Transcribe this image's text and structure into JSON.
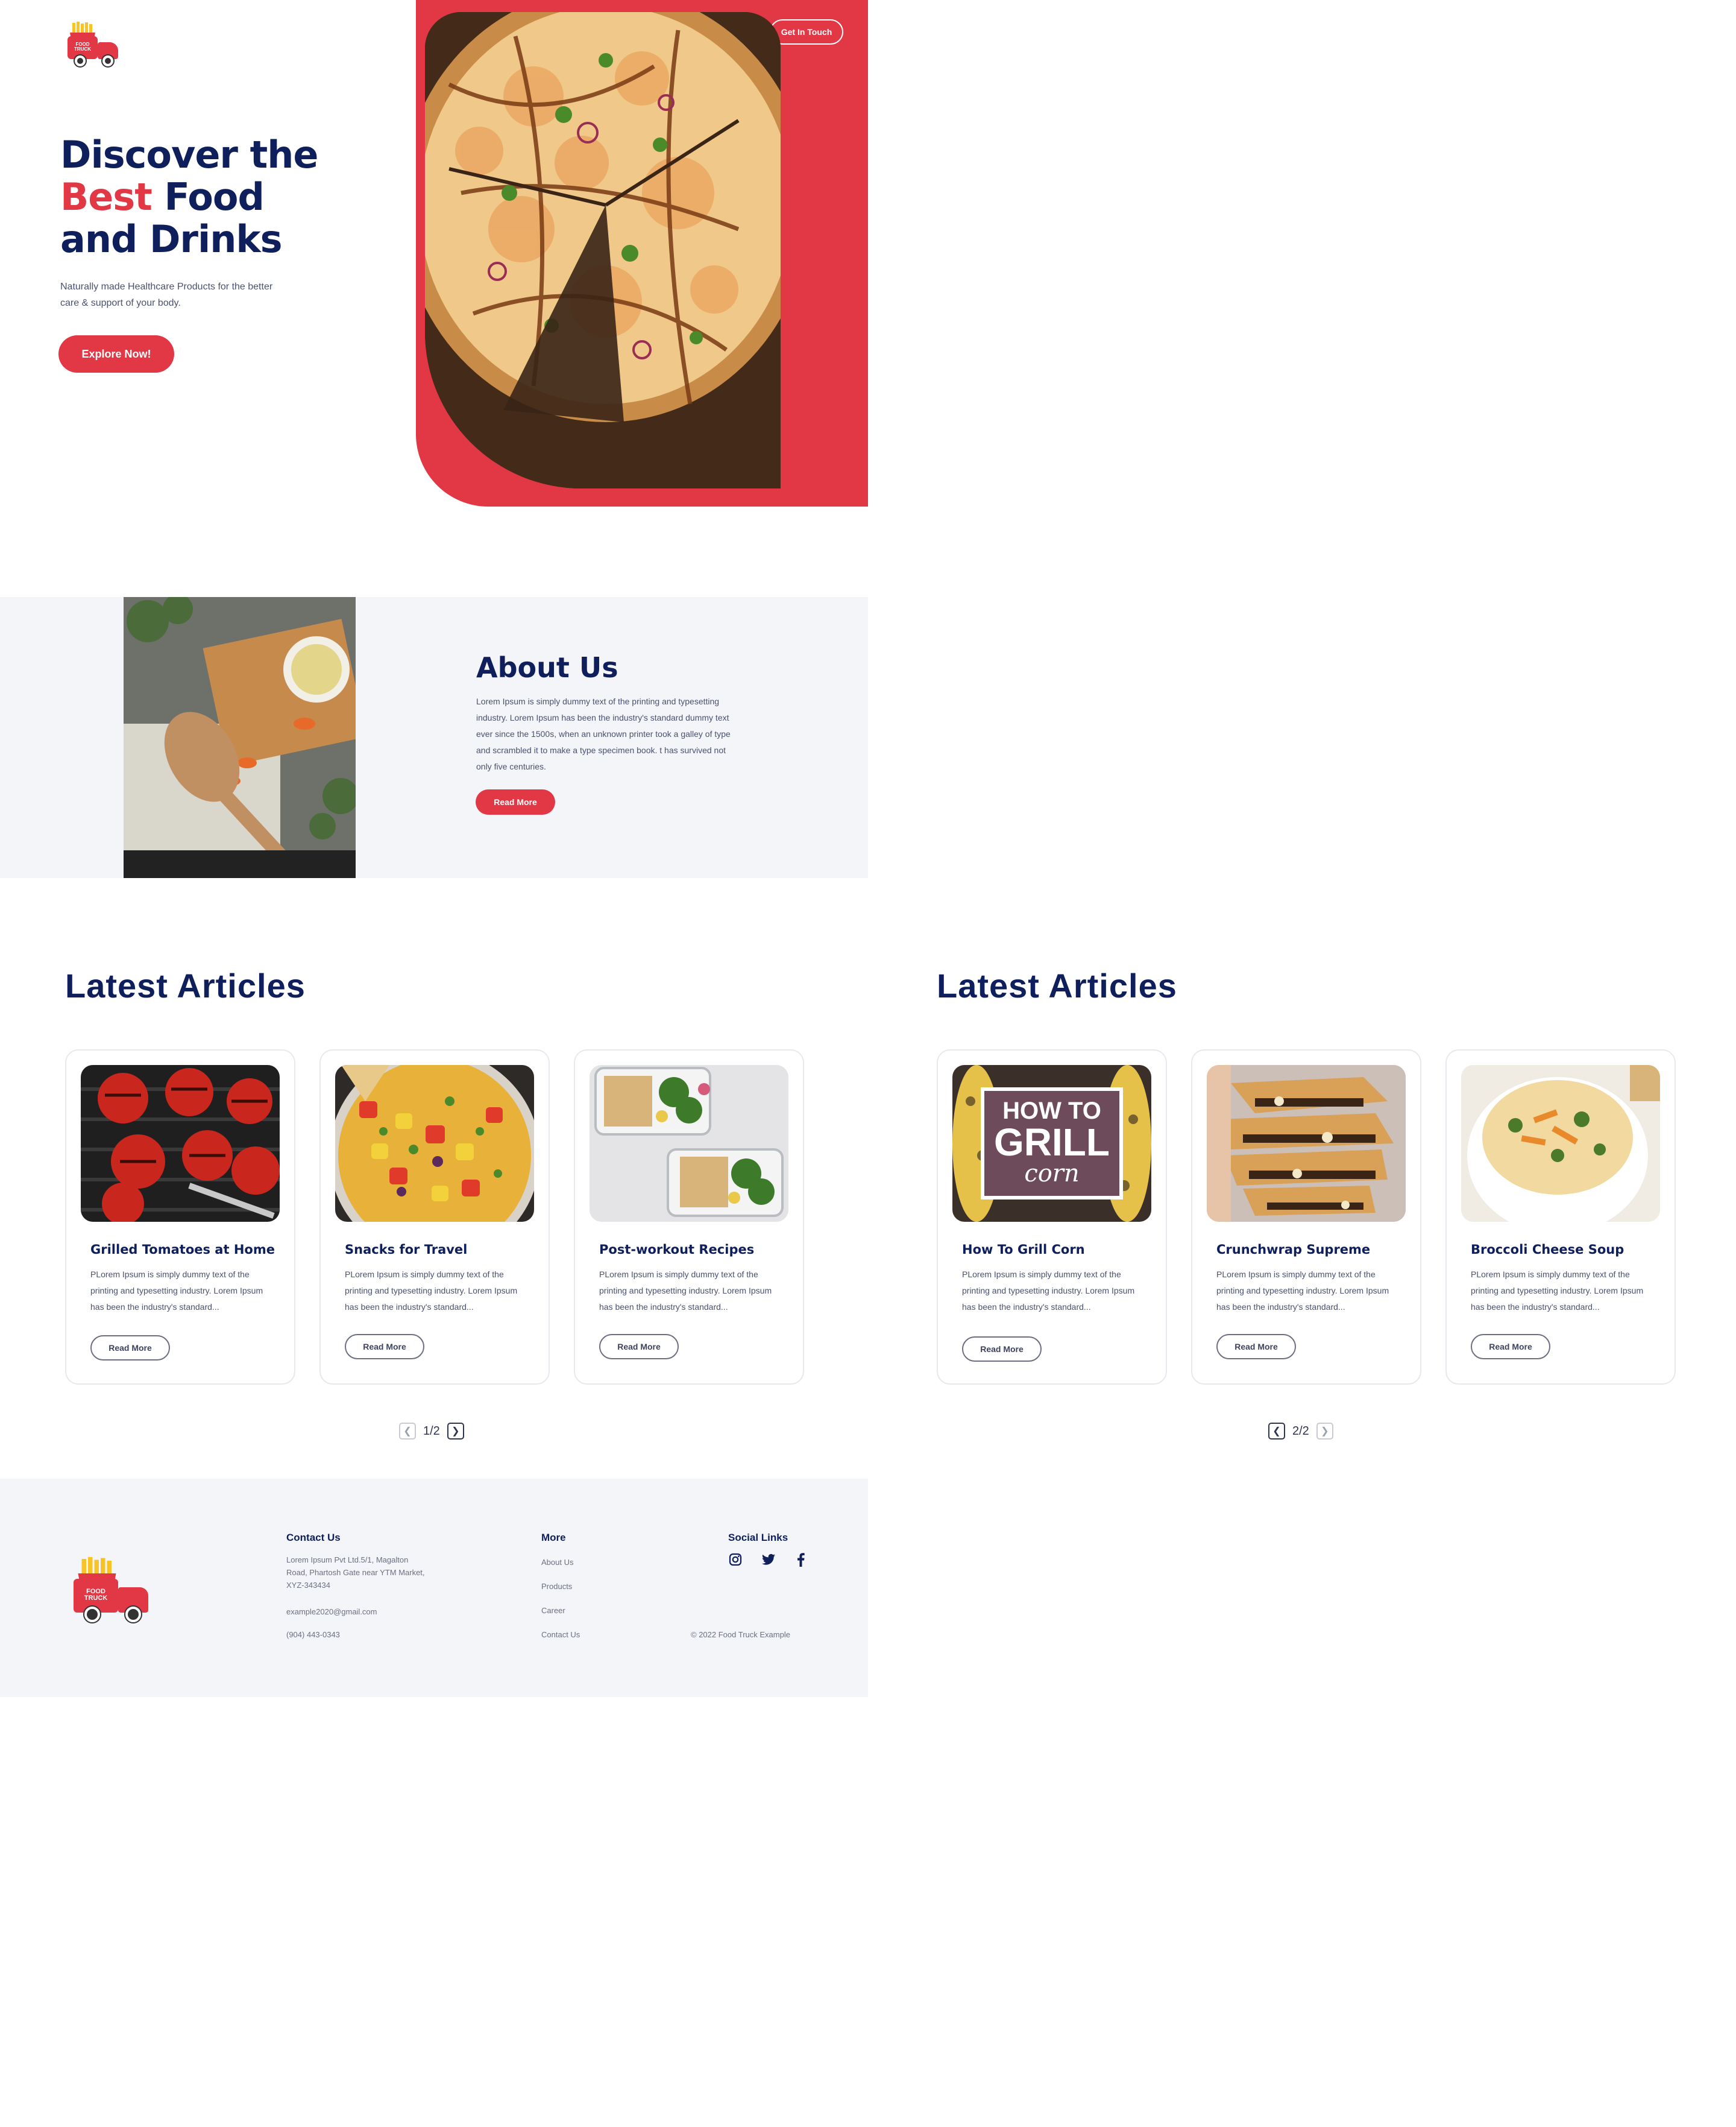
{
  "logo": {
    "text_line1": "FOOD",
    "text_line2": "TRUCK"
  },
  "hero": {
    "title_line1": "Discover the",
    "title_accent": "Best",
    "title_line2_rest": " Food",
    "title_line3": "and Drinks",
    "description": "Naturally made Healthcare Products for the better care & support of your body.",
    "cta_label": "Explore Now!",
    "contact_label": "Get In Touch"
  },
  "about": {
    "title": "About Us",
    "text": "Lorem Ipsum is simply dummy text of the printing and typesetting industry. Lorem Ipsum has been the industry's standard dummy text ever since the 1500s, when an unknown printer took a galley of type and scrambled it to make a type specimen book. t has survived not only five centuries.",
    "button_label": "Read More"
  },
  "articles_page1": {
    "title": "Latest Articles",
    "cards": [
      {
        "title": "Grilled  Tomatoes at Home",
        "text": "PLorem Ipsum is simply dummy text of the printing and typesetting industry. Lorem Ipsum has been the industry's standard...",
        "button": "Read More",
        "image": "grilled-tomatoes"
      },
      {
        "title": "Snacks for Travel",
        "text": "PLorem Ipsum is simply dummy text of the printing and typesetting industry. Lorem Ipsum has been the industry's standard...",
        "button": "Read More",
        "image": "fruit-salsa"
      },
      {
        "title": "Post-workout Recipes",
        "text": "PLorem Ipsum is simply dummy text of the printing and typesetting industry. Lorem Ipsum has been the industry's standard...",
        "button": "Read More",
        "image": "meal-prep"
      }
    ],
    "pager": "1/2"
  },
  "articles_page2": {
    "title": "Latest Articles",
    "cards": [
      {
        "title": "How To Grill Corn",
        "text": "PLorem Ipsum is simply dummy text of the printing and typesetting industry. Lorem Ipsum has been the industry's standard...",
        "button": "Read More",
        "image": "grill-corn",
        "overlay_line1": "HOW TO",
        "overlay_line2": "GRILL",
        "overlay_line3": "corn"
      },
      {
        "title": "Crunchwrap Supreme",
        "text": "PLorem Ipsum is simply dummy text of the printing and typesetting industry. Lorem Ipsum has been the industry's standard...",
        "button": "Read More",
        "image": "crunchwrap"
      },
      {
        "title": "Broccoli Cheese Soup",
        "text": "PLorem Ipsum is simply dummy text of the printing and typesetting industry. Lorem Ipsum has been the industry's standard...",
        "button": "Read More",
        "image": "broccoli-soup"
      }
    ],
    "pager": "2/2"
  },
  "footer": {
    "contact_heading": "Contact Us",
    "address": "Lorem Ipsum Pvt Ltd.5/1, Magalton Road, Phartosh Gate near YTM Market, XYZ-343434",
    "email": "example2020@gmail.com",
    "phone": "(904) 443-0343",
    "more_heading": "More",
    "more_links": [
      "About Us",
      "Products",
      "Career",
      "Contact Us"
    ],
    "social_heading": "Social Links",
    "social_icons": [
      "instagram-icon",
      "twitter-icon",
      "facebook-icon"
    ],
    "copyright": "© 2022 Food Truck Example"
  },
  "colors": {
    "accent": "#e23744",
    "navy": "#0f1f5c",
    "band": "#f4f5f8"
  }
}
